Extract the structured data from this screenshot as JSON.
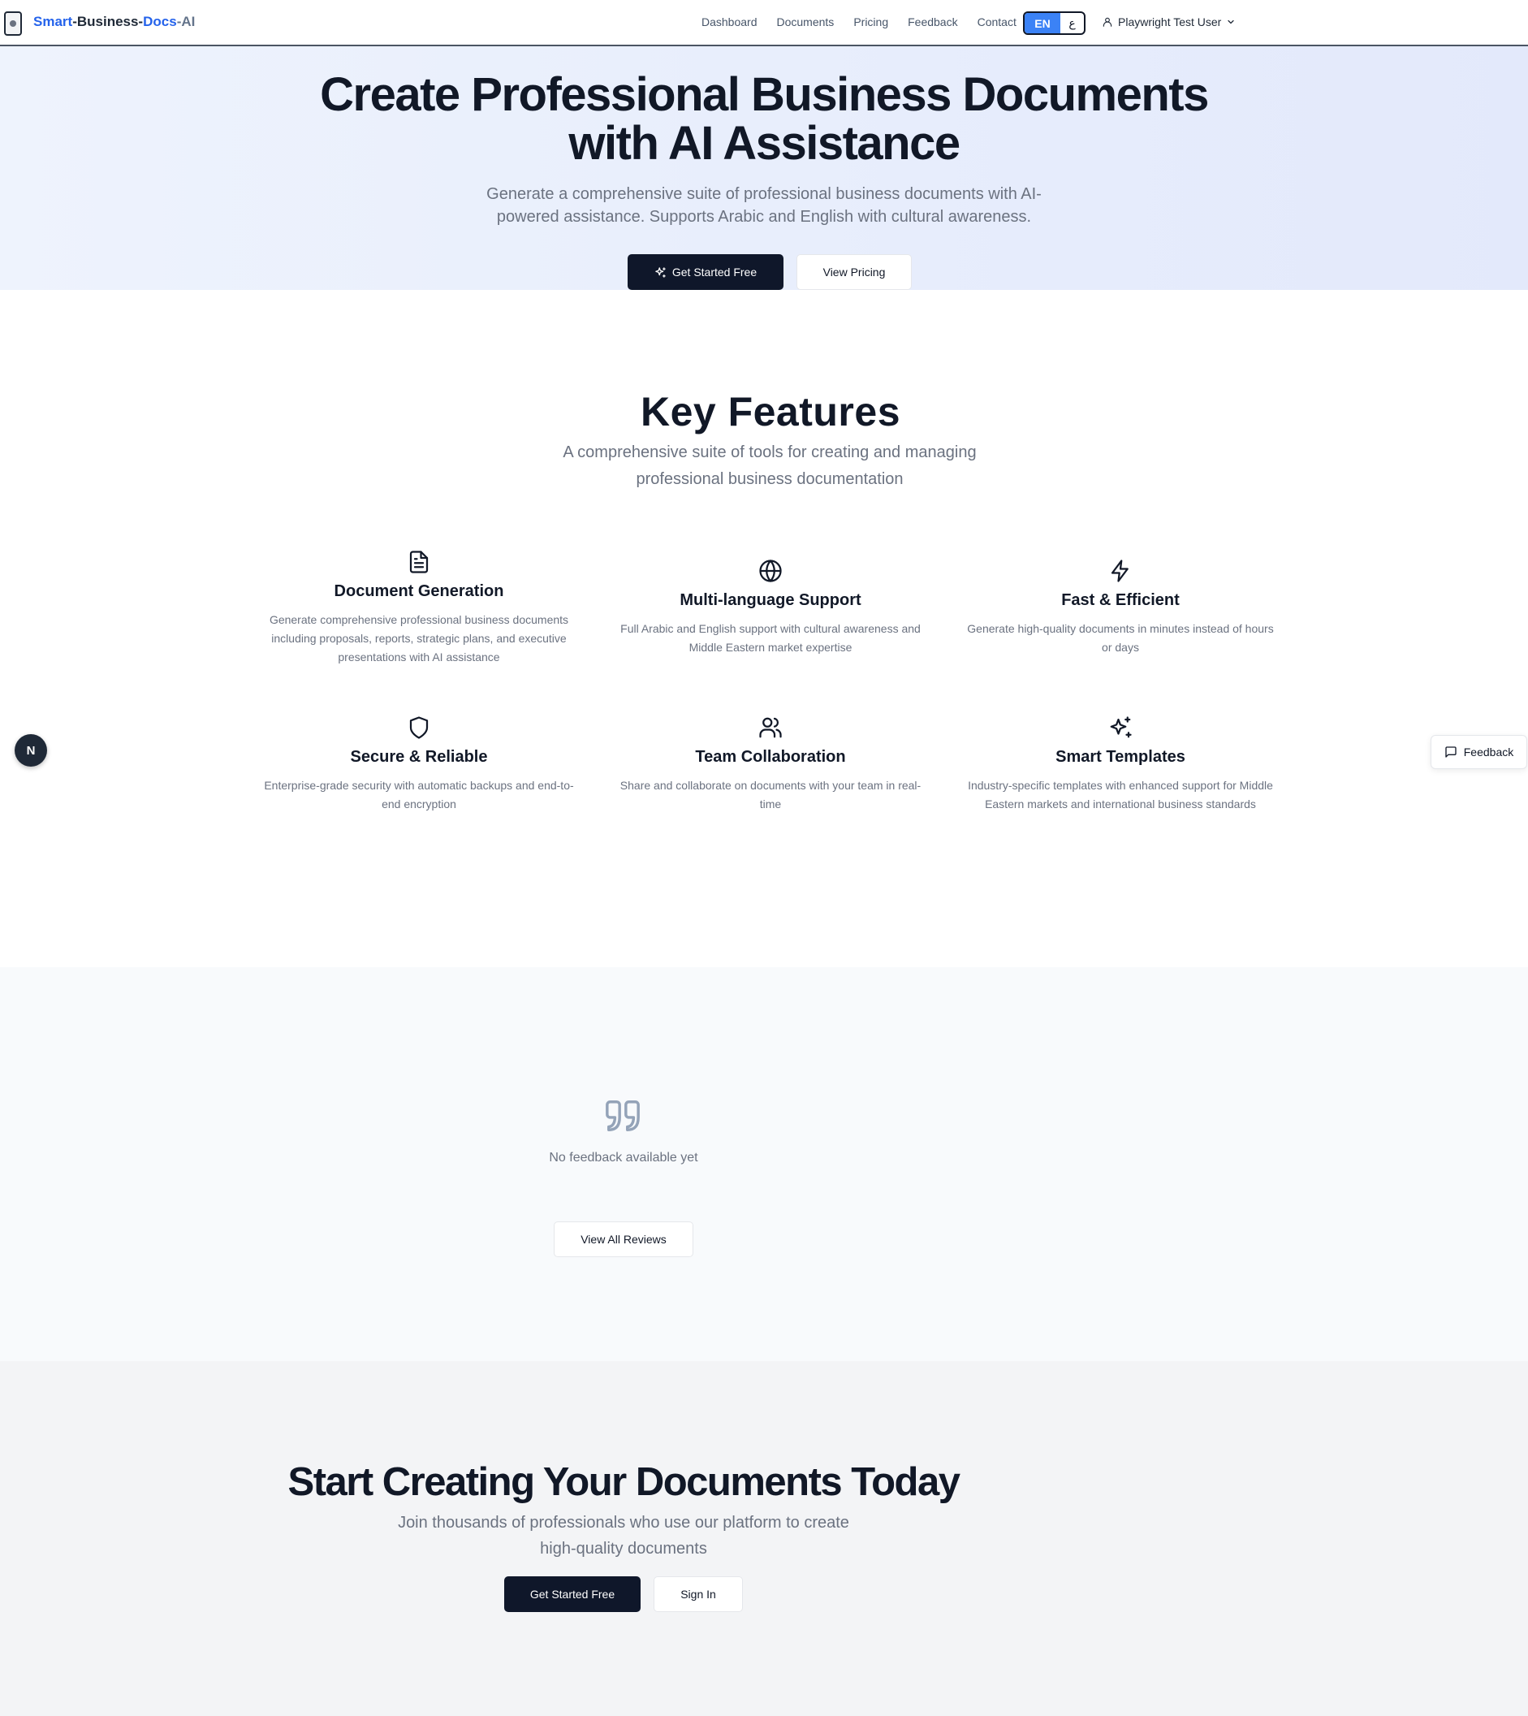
{
  "header": {
    "brand_parts": [
      "Smart",
      "-Business-",
      "Docs",
      "-AI"
    ],
    "nav": [
      "Dashboard",
      "Documents",
      "Pricing",
      "Feedback",
      "Contact"
    ],
    "lang_en": "EN",
    "lang_ar": "ع",
    "user_name": "Playwright Test User"
  },
  "hero": {
    "title_line1": "Create Professional Business Documents",
    "title_line2": "with AI Assistance",
    "subtitle": "Generate a comprehensive suite of professional business documents with AI-powered assistance. Supports Arabic and English with cultural awareness.",
    "primary_button": "Get Started Free",
    "secondary_button": "View Pricing"
  },
  "features": {
    "title": "Key Features",
    "subtitle": "A comprehensive suite of tools for creating and managing professional business documentation",
    "items": [
      {
        "icon": "document-icon",
        "title": "Document Generation",
        "text": "Generate comprehensive professional business documents including proposals, reports, strategic plans, and executive presentations with AI assistance"
      },
      {
        "icon": "globe-icon",
        "title": "Multi-language Support",
        "text": "Full Arabic and English support with cultural awareness and Middle Eastern market expertise"
      },
      {
        "icon": "lightning-icon",
        "title": "Fast & Efficient",
        "text": "Generate high-quality documents in minutes instead of hours or days"
      },
      {
        "icon": "shield-icon",
        "title": "Secure & Reliable",
        "text": "Enterprise-grade security with automatic backups and end-to-end encryption"
      },
      {
        "icon": "users-icon",
        "title": "Team Collaboration",
        "text": "Share and collaborate on documents with your team in real-time"
      },
      {
        "icon": "sparkles-icon",
        "title": "Smart Templates",
        "text": "Industry-specific templates with enhanced support for Middle Eastern markets and international business standards"
      }
    ]
  },
  "testimonials": {
    "empty_text": "No feedback available yet",
    "view_all": "View All Reviews"
  },
  "cta": {
    "title": "Start Creating Your Documents Today",
    "subtitle": "Join thousands of professionals who use our platform to create high-quality documents",
    "primary_button": "Get Started Free",
    "secondary_button": "Sign In"
  },
  "floating": {
    "badge": "N",
    "feedback": "Feedback"
  },
  "colors": {
    "brand_blue": "#2563eb",
    "primary_dark": "#0f172a",
    "lang_active": "#3b82f6"
  }
}
